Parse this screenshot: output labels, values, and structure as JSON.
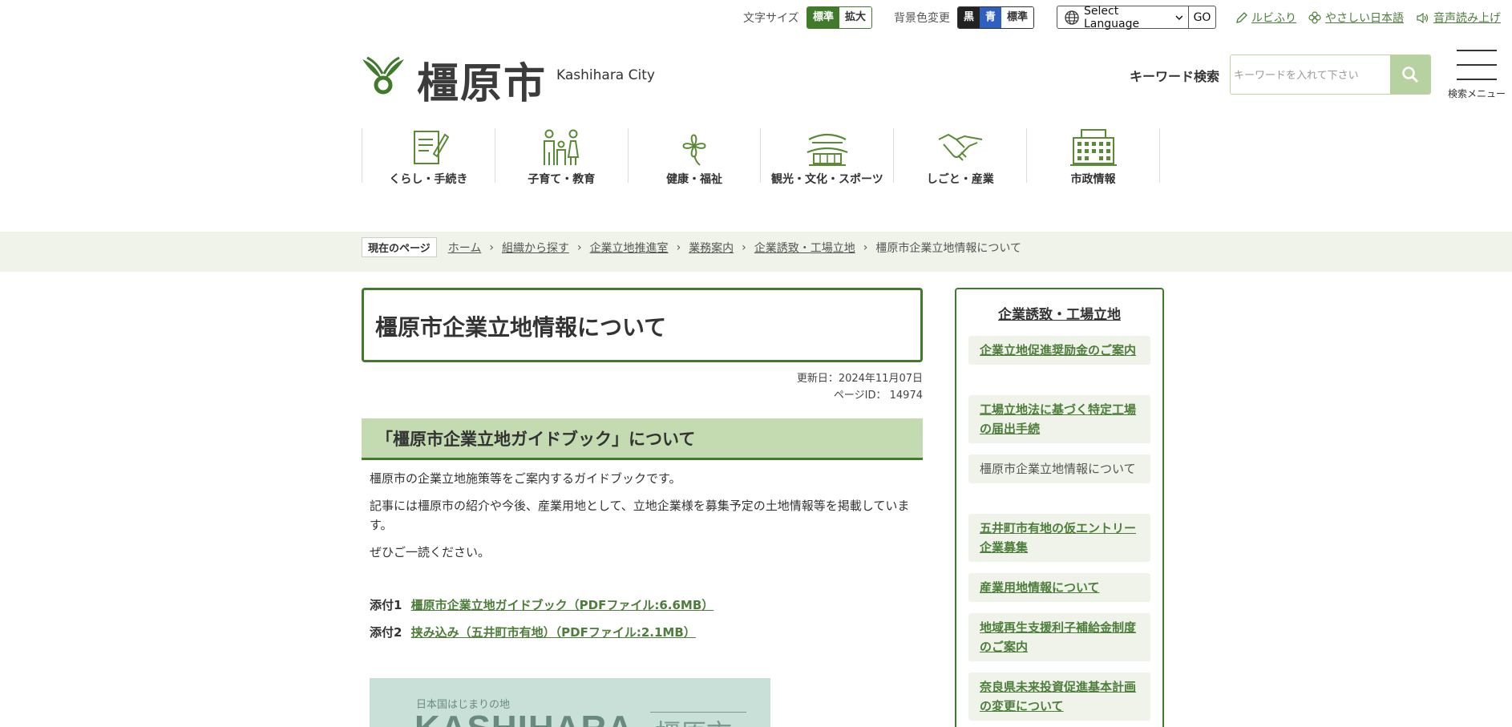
{
  "utility": {
    "font_size_label": "文字サイズ",
    "font_size_options": [
      "標準",
      "拡大"
    ],
    "bg_color_label": "背景色変更",
    "bg_color_options": [
      "黒",
      "青",
      "標準"
    ],
    "language_select": "Select Language",
    "go_label": "GO",
    "ruby_link": "ルビふり",
    "easy_japanese_link": "やさしい日本語",
    "read_aloud_link": "音声読み上げ"
  },
  "header": {
    "site_name": "橿原市",
    "site_name_en": "Kashihara City",
    "keyword_search_label": "キーワード検索",
    "search_placeholder": "キーワードを入れて下さい",
    "menu_label": "検索メニュー"
  },
  "global_nav": [
    {
      "label": "くらし・手続き",
      "icon": "document-pen-icon"
    },
    {
      "label": "子育て・教育",
      "icon": "family-icon"
    },
    {
      "label": "健康・福祉",
      "icon": "clover-icon"
    },
    {
      "label": "観光・文化・スポーツ",
      "icon": "shrine-icon"
    },
    {
      "label": "しごと・産業",
      "icon": "handshake-icon"
    },
    {
      "label": "市政情報",
      "icon": "city-hall-icon"
    }
  ],
  "breadcrumb": {
    "here_label": "現在のページ",
    "items": [
      "ホーム",
      "組織から探す",
      "企業立地推進室",
      "業務案内",
      "企業誘致・工場立地"
    ],
    "current": "橿原市企業立地情報について"
  },
  "main": {
    "title": "橿原市企業立地情報について",
    "updated": "更新日：2024年11月07日",
    "page_id": "ページID： 14974",
    "section_title": "「橿原市企業立地ガイドブック」について",
    "paragraphs": [
      "橿原市の企業立地施策等をご案内するガイドブックです。",
      "記事には橿原市の紹介や今後、産業用地として、立地企業様を募集予定の土地情報等を掲載しています。",
      "ぜひご一読ください。"
    ],
    "attachments": [
      {
        "label": "添付1",
        "link": "橿原市企業立地ガイドブック（PDFファイル:6.6MB）"
      },
      {
        "label": "添付2",
        "link": "挟み込み（五井町市有地）（PDFファイル:2.1MB）"
      }
    ],
    "banner": {
      "tagline": "日本国はじまりの地",
      "title": "KASHIHARA",
      "title_jp": "橿原市"
    }
  },
  "sidebar": {
    "title": "企業誘致・工場立地",
    "items": [
      {
        "label": "企業立地促進奨励金のご案内",
        "current": false
      },
      {
        "label": "工場立地法に基づく特定工場の届出手続",
        "current": false
      },
      {
        "label": "橿原市企業立地情報について",
        "current": true
      },
      {
        "label": "五井町市有地の仮エントリー企業募集",
        "current": false
      },
      {
        "label": "産業用地情報について",
        "current": false
      },
      {
        "label": "地域再生支援利子補給金制度のご案内",
        "current": false
      },
      {
        "label": "奈良県未来投資促進基本計画の変更について",
        "current": false
      }
    ]
  },
  "colors": {
    "accent_green": "#3f7b2a",
    "link_green": "#4d7d3a",
    "light_green": "#c4dbb2",
    "band_bg": "#eff3ea"
  }
}
